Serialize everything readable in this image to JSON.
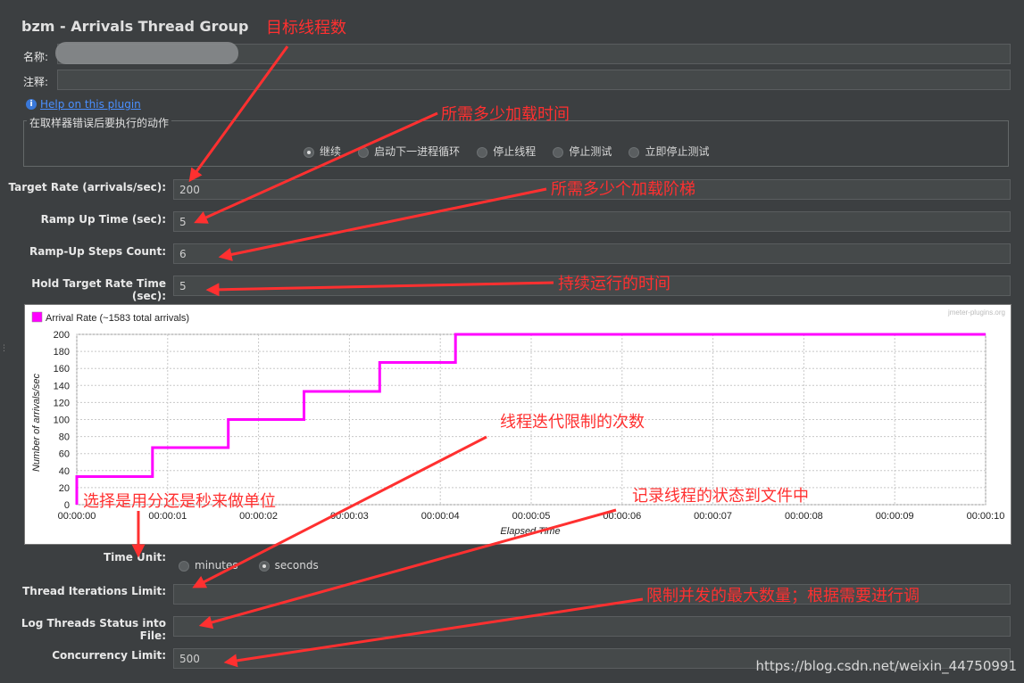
{
  "panel": {
    "title": "bzm - Arrivals Thread Group",
    "name_label": "名称:",
    "comment_label": "注释:",
    "help_link": "Help on this plugin"
  },
  "error_action": {
    "legend": "在取样器错误后要执行的动作",
    "options": [
      "继续",
      "启动下一进程循环",
      "停止线程",
      "停止测试",
      "立即停止测试"
    ],
    "selected": "继续"
  },
  "fields": {
    "target_rate": {
      "label": "Target Rate (arrivals/sec):",
      "value": "200"
    },
    "ramp_up_time": {
      "label": "Ramp Up Time (sec):",
      "value": "5"
    },
    "ramp_up_steps": {
      "label": "Ramp-Up Steps Count:",
      "value": "6"
    },
    "hold_time": {
      "label": "Hold Target Rate Time (sec):",
      "value": "5"
    },
    "time_unit": {
      "label": "Time Unit:",
      "options": [
        "minutes",
        "seconds"
      ],
      "selected": "seconds"
    },
    "thread_iterations": {
      "label": "Thread Iterations Limit:",
      "value": ""
    },
    "log_threads": {
      "label": "Log Threads Status into File:",
      "value": ""
    },
    "concurrency": {
      "label": "Concurrency Limit:",
      "value": "500"
    }
  },
  "chart_data": {
    "type": "line",
    "legend": "Arrival Rate (~1583 total arrivals)",
    "watermark": "jmeter-plugins.org",
    "xlabel": "Elapsed Time",
    "ylabel": "Number of arrivals/sec",
    "ylim": [
      0,
      200
    ],
    "yticks": [
      "0",
      "20",
      "40",
      "60",
      "80",
      "100",
      "120",
      "140",
      "160",
      "180",
      "200"
    ],
    "xticks": [
      "00:00:00",
      "00:00:01",
      "00:00:02",
      "00:00:03",
      "00:00:04",
      "00:00:05",
      "00:00:06",
      "00:00:07",
      "00:00:08",
      "00:00:09",
      "00:00:10"
    ],
    "xlim_sec": [
      0,
      10
    ],
    "series": [
      {
        "name": "Arrival Rate",
        "color": "#ff00ff",
        "points": [
          [
            0,
            0
          ],
          [
            0,
            33
          ],
          [
            0.833,
            33
          ],
          [
            0.833,
            67
          ],
          [
            1.667,
            67
          ],
          [
            1.667,
            100
          ],
          [
            2.5,
            100
          ],
          [
            2.5,
            133
          ],
          [
            3.333,
            133
          ],
          [
            3.333,
            167
          ],
          [
            4.167,
            167
          ],
          [
            4.167,
            200
          ],
          [
            10,
            200
          ]
        ]
      }
    ],
    "grid": true
  },
  "annotations": {
    "target_threads": "目标线程数",
    "load_time": "所需多少加载时间",
    "load_steps": "所需多少个加载阶梯",
    "duration": "持续运行的时间",
    "iterations": "线程迭代限制的次数",
    "unit": "选择是用分还是秒来做单位",
    "log": "记录线程的状态到文件中",
    "concurrency": "限制并发的最大数量；根据需要进行调"
  },
  "watermark": "https://blog.csdn.net/weixin_44750991",
  "colors": {
    "background": "#3c3f41",
    "annotation": "#ff3030",
    "series": "#ff00ff"
  }
}
